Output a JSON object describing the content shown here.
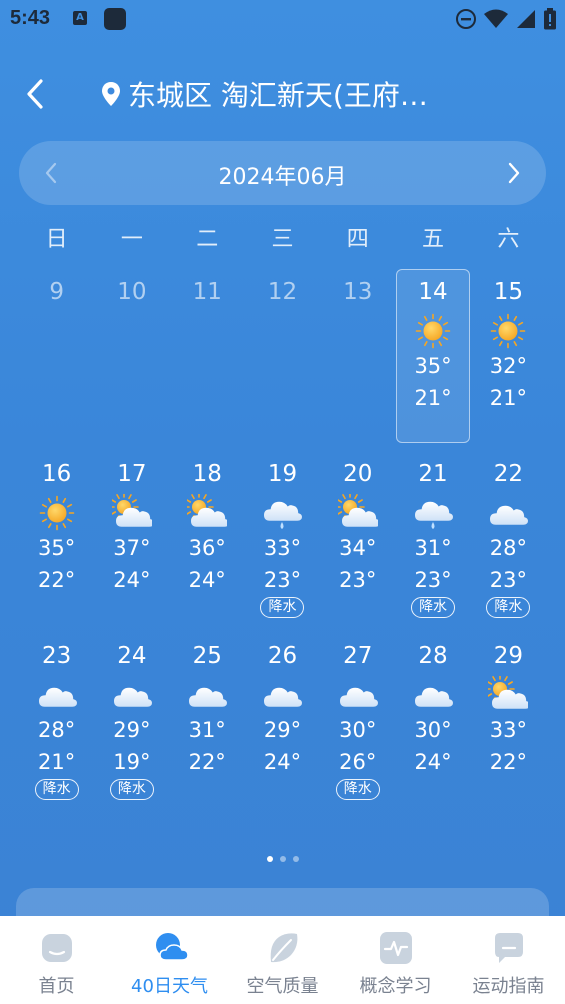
{
  "status_bar": {
    "time": "5:43",
    "icons": [
      "notification-a-icon",
      "app-square-icon",
      "do-not-disturb-icon",
      "wifi-icon",
      "signal-icon",
      "battery-icon"
    ]
  },
  "header": {
    "back_icon": "chevron-left-icon",
    "location_icon": "map-pin-icon",
    "location": "东城区 淘汇新天(王府…"
  },
  "month_nav": {
    "title": "2024年06月",
    "prev_icon": "chevron-left-icon",
    "next_icon": "chevron-right-icon"
  },
  "weekdays": [
    "日",
    "一",
    "二",
    "三",
    "四",
    "五",
    "六"
  ],
  "days": [
    {
      "day": "9",
      "past": true
    },
    {
      "day": "10",
      "past": true
    },
    {
      "day": "11",
      "past": true
    },
    {
      "day": "12",
      "past": true
    },
    {
      "day": "13",
      "past": true
    },
    {
      "day": "14",
      "icon": "sunny",
      "high": "35°",
      "low": "21°",
      "selected": true
    },
    {
      "day": "15",
      "icon": "sunny",
      "high": "32°",
      "low": "21°"
    },
    {
      "day": "16",
      "icon": "sunny",
      "high": "35°",
      "low": "22°"
    },
    {
      "day": "17",
      "icon": "partly-cloudy",
      "high": "37°",
      "low": "24°"
    },
    {
      "day": "18",
      "icon": "partly-cloudy",
      "high": "36°",
      "low": "24°"
    },
    {
      "day": "19",
      "icon": "rain",
      "high": "33°",
      "low": "23°",
      "badge": "降水"
    },
    {
      "day": "20",
      "icon": "partly-cloudy",
      "high": "34°",
      "low": "23°"
    },
    {
      "day": "21",
      "icon": "rain",
      "high": "31°",
      "low": "23°",
      "badge": "降水"
    },
    {
      "day": "22",
      "icon": "cloudy",
      "high": "28°",
      "low": "23°",
      "badge": "降水"
    },
    {
      "day": "23",
      "icon": "cloudy",
      "high": "28°",
      "low": "21°",
      "badge": "降水"
    },
    {
      "day": "24",
      "icon": "cloudy",
      "high": "29°",
      "low": "19°",
      "badge": "降水"
    },
    {
      "day": "25",
      "icon": "cloudy",
      "high": "31°",
      "low": "22°"
    },
    {
      "day": "26",
      "icon": "cloudy",
      "high": "29°",
      "low": "24°"
    },
    {
      "day": "27",
      "icon": "cloudy",
      "high": "30°",
      "low": "26°",
      "badge": "降水"
    },
    {
      "day": "28",
      "icon": "cloudy",
      "high": "30°",
      "low": "24°"
    },
    {
      "day": "29",
      "icon": "partly-cloudy",
      "high": "33°",
      "low": "22°"
    }
  ],
  "pager": {
    "count": 3,
    "active": 0
  },
  "bottom_nav": [
    {
      "label": "首页",
      "icon": "home-face-icon",
      "active": false
    },
    {
      "label": "40日天气",
      "icon": "weather-cloud-icon",
      "active": true
    },
    {
      "label": "空气质量",
      "icon": "leaf-icon",
      "active": false
    },
    {
      "label": "概念学习",
      "icon": "pulse-icon",
      "active": false
    },
    {
      "label": "运动指南",
      "icon": "chat-bubble-icon",
      "active": false
    }
  ],
  "colors": {
    "background": "#3b86d9",
    "nav_active": "#2f8ef0",
    "nav_inactive": "#7a8290",
    "sun": "#f5a623"
  }
}
